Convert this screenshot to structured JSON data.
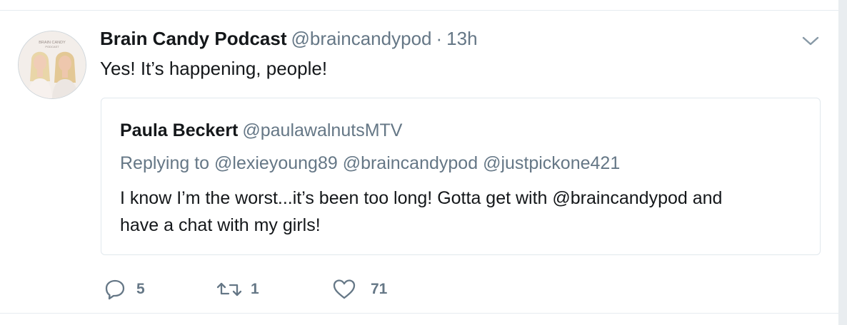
{
  "tweet": {
    "author_name": "Brain Candy Podcast",
    "author_handle": "@braincandypod",
    "separator": "·",
    "timestamp": "13h",
    "text": "Yes! It’s happening, people!",
    "avatar_caption": "BRAIN CANDY PODCAST"
  },
  "quoted_tweet": {
    "author_name": "Paula Beckert",
    "author_handle": "@paulawalnutsMTV",
    "replying_prefix": "Replying to",
    "replying_to": [
      "@lexieyoung89",
      "@braincandypod",
      "@justpickone421"
    ],
    "text_line1": "I know I’m the worst...it’s been too long! Gotta get with @braincandypod and",
    "text_line2": "have a chat with my girls!"
  },
  "actions": {
    "reply_count": "5",
    "retweet_count": "1",
    "like_count": "71"
  },
  "colors": {
    "text": "#14171a",
    "secondary": "#657786",
    "border": "#e1e8ed"
  },
  "icons": [
    "chevron-down-icon",
    "reply-icon",
    "retweet-icon",
    "like-icon"
  ]
}
